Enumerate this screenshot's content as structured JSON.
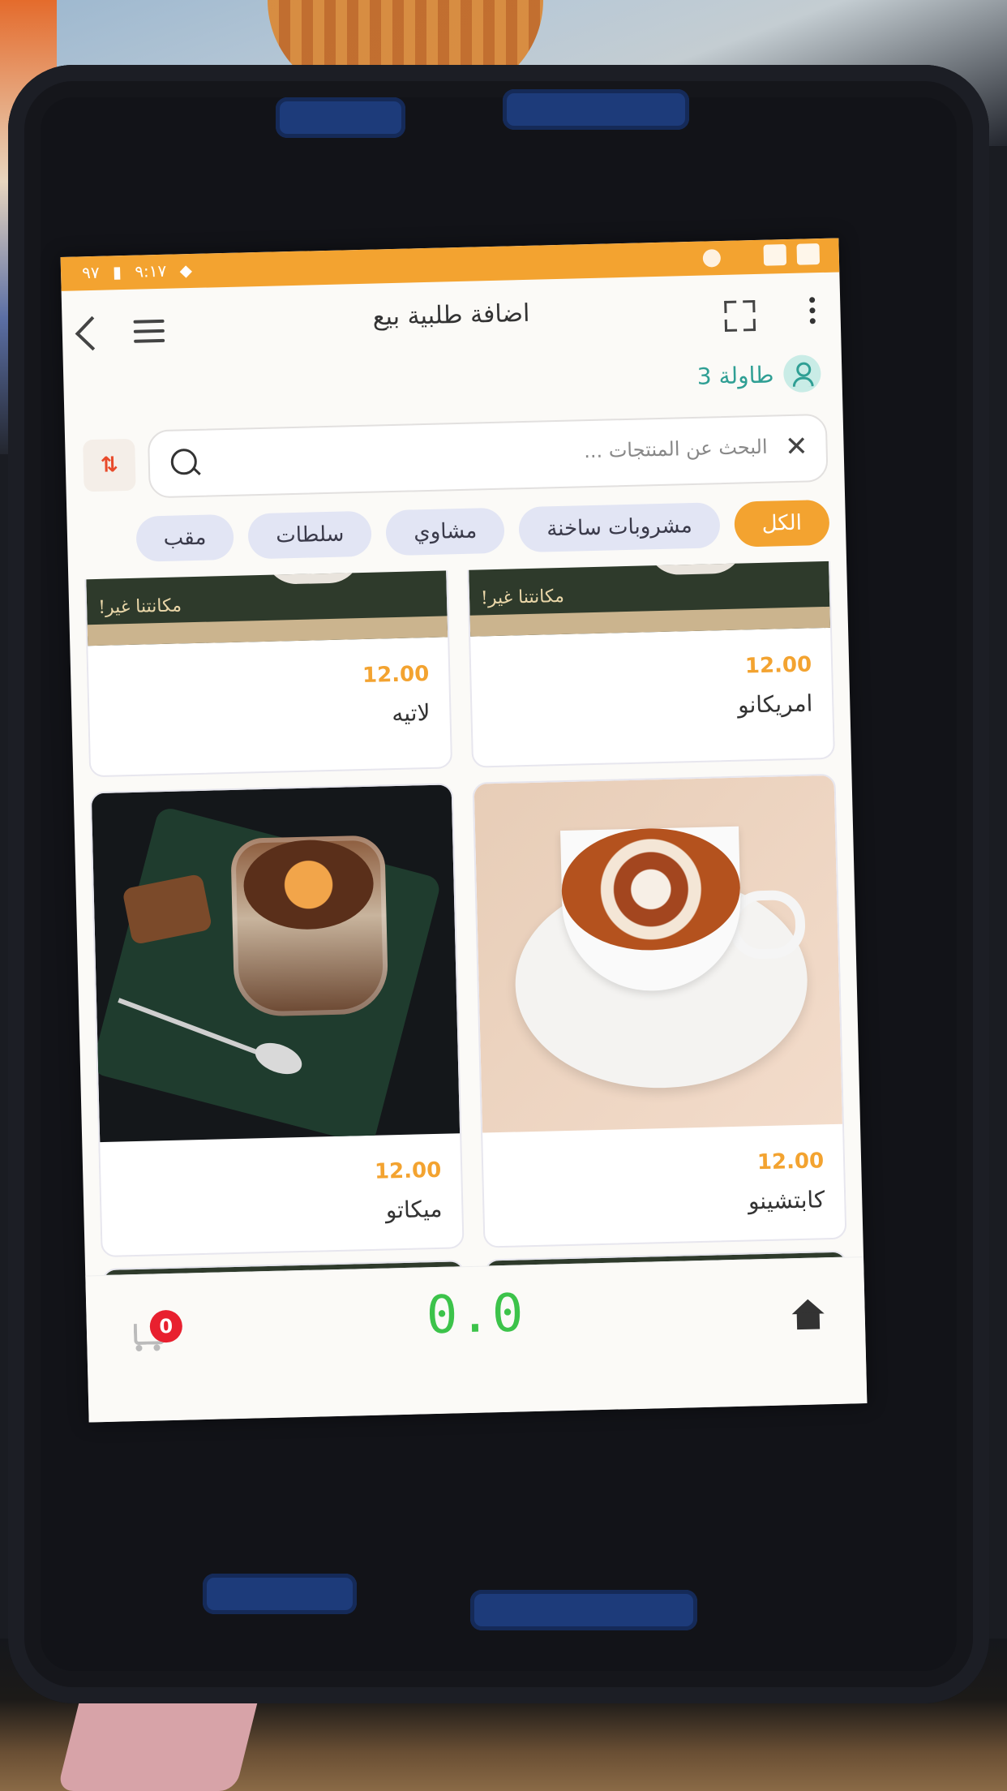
{
  "status_bar": {
    "time": "٩:١٧",
    "battery": "٩٧"
  },
  "header": {
    "title": "اضافة طلبية بيع"
  },
  "table": {
    "label": "طاولة 3"
  },
  "search": {
    "placeholder": "البحث عن المنتجات ..."
  },
  "categories": [
    {
      "label": "الكل",
      "active": true
    },
    {
      "label": "مشروبات ساخنة",
      "active": false
    },
    {
      "label": "مشاوي",
      "active": false
    },
    {
      "label": "سلطات",
      "active": false
    },
    {
      "label": "مقب",
      "active": false
    }
  ],
  "products": [
    {
      "name": "امريكانو",
      "price": "12.00",
      "image": "coffee-banner",
      "banner_text": "مكانتنا غير!"
    },
    {
      "name": "لاتيه",
      "price": "12.00",
      "image": "coffee-banner",
      "banner_text": "مكانتنا غير!"
    },
    {
      "name": "كابتشينو",
      "price": "12.00",
      "image": "cappuccino-photo"
    },
    {
      "name": "ميكاتو",
      "price": "12.00",
      "image": "mocha-photo"
    }
  ],
  "bottom_bar": {
    "total": "0.0",
    "cart_count": "0"
  },
  "colors": {
    "accent": "#f3a330",
    "teal": "#2f9f94",
    "total_green": "#3cc34a",
    "badge_red": "#e8202f"
  }
}
